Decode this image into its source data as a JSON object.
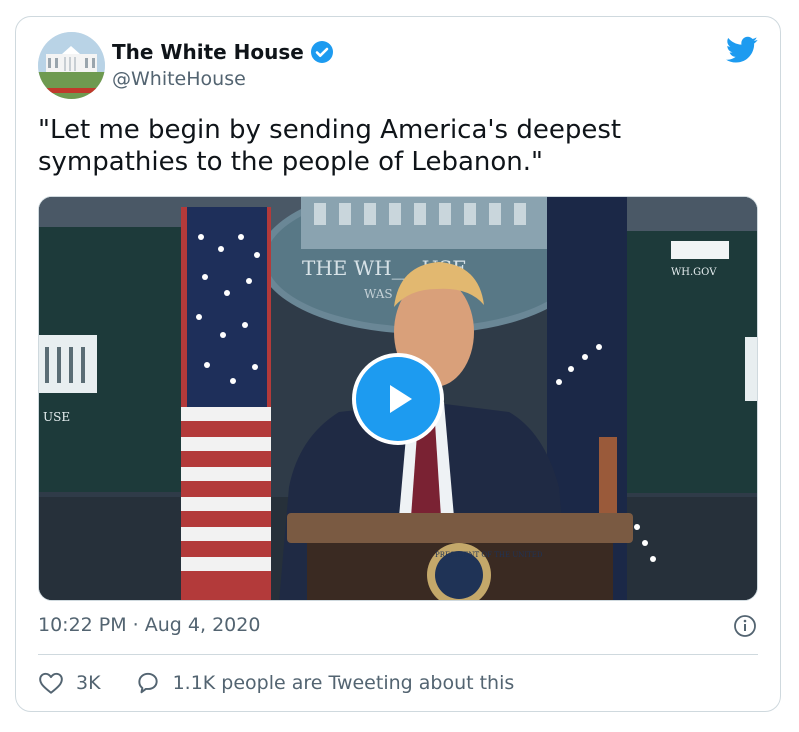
{
  "account": {
    "name": "The White House",
    "handle": "@WhiteHouse",
    "verified": true
  },
  "tweet": {
    "text": "\"Let me begin by sending America's deepest sympathies to the people of Lebanon.\"",
    "timestamp": "10:22 PM · Aug 4, 2020"
  },
  "video": {
    "backdrop_sign_text": "THE WH___USE",
    "backdrop_sub_text": "WAS",
    "left_screen_text": "USE",
    "right_screen_text": "WH.GOV",
    "seal_text": "PRESIDENT OF THE UNITED"
  },
  "actions": {
    "likes": "3K",
    "tweeting": "1.1K people are Tweeting about this"
  },
  "icons": {
    "verified_badge": "verified-badge-icon",
    "brand": "twitter-bird-icon",
    "play": "play-icon",
    "info": "info-icon",
    "like": "heart-icon",
    "reply": "comment-bubble-icon"
  },
  "colors": {
    "accent": "#1d9bf0",
    "text": "#0f1419",
    "muted": "#536471",
    "border": "#cfd9de"
  }
}
